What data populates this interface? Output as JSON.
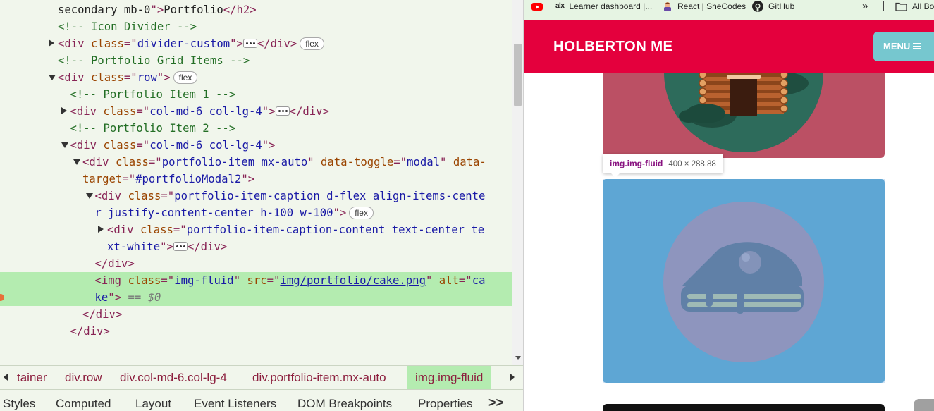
{
  "devtools": {
    "elements": {
      "lines": [
        {
          "indent": 5,
          "toggle": "none",
          "parts": [
            [
              "txt",
              "secondary mb-0"
            ],
            [
              "tag",
              "\">"
            ],
            [
              "txt",
              "Portfolio"
            ],
            [
              "tag",
              "</h2>"
            ]
          ]
        },
        {
          "indent": 5,
          "toggle": "none",
          "parts": [
            [
              "cmt",
              "<!-- Icon Divider -->"
            ]
          ]
        },
        {
          "indent": 5,
          "toggle": "right",
          "parts": [
            [
              "tag",
              "<div "
            ],
            [
              "attr",
              "class"
            ],
            [
              "tag",
              "=\""
            ],
            [
              "val",
              "divider-custom"
            ],
            [
              "tag",
              "\">"
            ],
            [
              "ell",
              ""
            ],
            [
              "tag",
              "</div>"
            ],
            [
              "pill",
              "flex"
            ]
          ]
        },
        {
          "indent": 5,
          "toggle": "none",
          "parts": [
            [
              "cmt",
              "<!-- Portfolio Grid Items -->"
            ]
          ]
        },
        {
          "indent": 5,
          "toggle": "down",
          "parts": [
            [
              "tag",
              "<div "
            ],
            [
              "attr",
              "class"
            ],
            [
              "tag",
              "=\""
            ],
            [
              "val",
              "row"
            ],
            [
              "tag",
              "\">"
            ],
            [
              "pill",
              "flex"
            ]
          ]
        },
        {
          "indent": 6,
          "toggle": "none",
          "parts": [
            [
              "cmt",
              "<!-- Portfolio Item 1 -->"
            ]
          ]
        },
        {
          "indent": 6,
          "toggle": "right",
          "parts": [
            [
              "tag",
              "<div "
            ],
            [
              "attr",
              "class"
            ],
            [
              "tag",
              "=\""
            ],
            [
              "val",
              "col-md-6 col-lg-4"
            ],
            [
              "tag",
              "\">"
            ],
            [
              "ell",
              ""
            ],
            [
              "tag",
              "</div>"
            ]
          ]
        },
        {
          "indent": 6,
          "toggle": "none",
          "parts": [
            [
              "cmt",
              "<!-- Portfolio Item 2 -->"
            ]
          ]
        },
        {
          "indent": 6,
          "toggle": "down",
          "parts": [
            [
              "tag",
              "<div "
            ],
            [
              "attr",
              "class"
            ],
            [
              "tag",
              "=\""
            ],
            [
              "val",
              "col-md-6 col-lg-4"
            ],
            [
              "tag",
              "\">"
            ]
          ]
        },
        {
          "indent": 7,
          "toggle": "down",
          "parts": [
            [
              "tag",
              "<div "
            ],
            [
              "attr",
              "class"
            ],
            [
              "tag",
              "=\""
            ],
            [
              "val",
              "portfolio-item mx-auto"
            ],
            [
              "tag",
              "\" "
            ],
            [
              "attr",
              "data-toggle"
            ],
            [
              "tag",
              "=\""
            ],
            [
              "val",
              "modal"
            ],
            [
              "tag",
              "\" "
            ],
            [
              "attr",
              "data-"
            ]
          ]
        },
        {
          "indent": 7,
          "toggle": "none",
          "parts": [
            [
              "attr",
              "target"
            ],
            [
              "tag",
              "=\""
            ],
            [
              "val",
              "#portfolioModal2"
            ],
            [
              "tag",
              "\">"
            ]
          ]
        },
        {
          "indent": 8,
          "toggle": "down",
          "parts": [
            [
              "tag",
              "<div "
            ],
            [
              "attr",
              "class"
            ],
            [
              "tag",
              "=\""
            ],
            [
              "val",
              "portfolio-item-caption d-flex align-items-cente"
            ]
          ]
        },
        {
          "indent": 8,
          "toggle": "none",
          "parts": [
            [
              "val",
              "r justify-content-center h-100 w-100"
            ],
            [
              "tag",
              "\">"
            ],
            [
              "pill",
              "flex"
            ]
          ]
        },
        {
          "indent": 9,
          "toggle": "right",
          "parts": [
            [
              "tag",
              "<div "
            ],
            [
              "attr",
              "class"
            ],
            [
              "tag",
              "=\""
            ],
            [
              "val",
              "portfolio-item-caption-content text-center te"
            ]
          ]
        },
        {
          "indent": 9,
          "toggle": "none",
          "parts": [
            [
              "val",
              "xt-white"
            ],
            [
              "tag",
              "\">"
            ],
            [
              "ell",
              ""
            ],
            [
              "tag",
              "</div>"
            ]
          ]
        },
        {
          "indent": 8,
          "toggle": "none",
          "parts": [
            [
              "tag",
              "</div>"
            ]
          ]
        },
        {
          "indent": 8,
          "toggle": "none",
          "selected": true,
          "parts": [
            [
              "tag",
              "<img "
            ],
            [
              "attr",
              "class"
            ],
            [
              "tag",
              "=\""
            ],
            [
              "val",
              "img-fluid"
            ],
            [
              "tag",
              "\" "
            ],
            [
              "attr",
              "src"
            ],
            [
              "tag",
              "=\""
            ],
            [
              "link",
              "img/portfolio/cake.png"
            ],
            [
              "tag",
              "\" "
            ],
            [
              "attr",
              "alt"
            ],
            [
              "tag",
              "=\""
            ],
            [
              "val",
              "ca"
            ]
          ]
        },
        {
          "indent": 8,
          "toggle": "none",
          "selected": true,
          "parts": [
            [
              "val",
              "ke"
            ],
            [
              "tag",
              "\">"
            ],
            [
              "eq",
              " == $0"
            ]
          ]
        },
        {
          "indent": 7,
          "toggle": "none",
          "parts": [
            [
              "tag",
              "</div>"
            ]
          ]
        },
        {
          "indent": 6,
          "toggle": "none",
          "parts": [
            [
              "tag",
              "</div>"
            ]
          ]
        }
      ]
    },
    "breadcrumbs": [
      "tainer",
      "div.row",
      "div.col-md-6.col-lg-4",
      "div.portfolio-item.mx-auto",
      "img.img-fluid"
    ],
    "tabs": [
      "Styles",
      "Computed",
      "Layout",
      "Event Listeners",
      "DOM Breakpoints",
      "Properties",
      ">>"
    ]
  },
  "browser": {
    "bookmarks": [
      "Learner dashboard |...",
      "React | SheCodes",
      "GitHub",
      "All Bo"
    ],
    "more_bookmarks": "»",
    "navbar": {
      "brand": "HOLBERTON ME",
      "menu_label": "MENU"
    },
    "tooltip": {
      "selector": "img.img-fluid",
      "size": "400 × 288.88"
    }
  },
  "colors": {
    "nav_red": "#e4003d",
    "menu_teal": "#76c7cf",
    "card_cabin_bg": "#bb5064",
    "card_cake_bg": "#56a5d0",
    "selection_green": "#b4ecb0"
  }
}
